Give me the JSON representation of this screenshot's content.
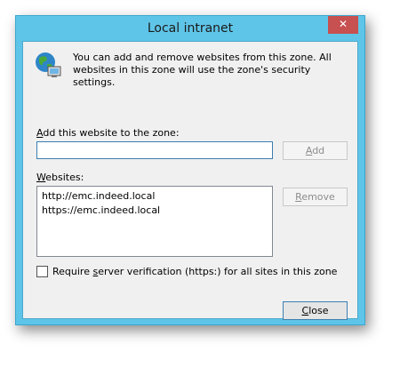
{
  "window": {
    "title": "Local intranet",
    "close_glyph": "✕"
  },
  "intro": {
    "icon": "globe-computer-icon",
    "text": "You can add and remove websites from this zone. All websites in this zone will use the zone's security settings."
  },
  "add_section": {
    "label": "Add this website to the zone:",
    "input_value": "",
    "add_button": "Add"
  },
  "websites": {
    "label": "Websites:",
    "items": [
      "http://emc.indeed.local",
      "https://emc.indeed.local"
    ],
    "remove_button": "Remove"
  },
  "require_verification": {
    "label": "Require server verification (https:) for all sites in this zone",
    "checked": false
  },
  "close_button": "Close",
  "colors": {
    "frame": "#5fc5e8",
    "close_red": "#c75050",
    "client": "#f0f0f0"
  }
}
